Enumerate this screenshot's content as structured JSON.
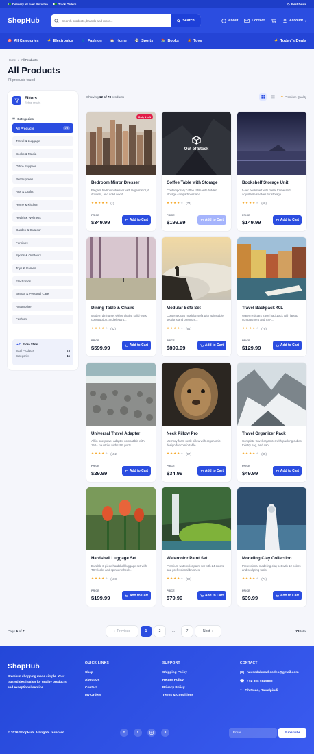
{
  "topbar": {
    "delivery": "Delivery all over Pakistan",
    "track": "Track Orders",
    "deals": "Best Deals"
  },
  "header": {
    "logo": "ShopHub",
    "search_placeholder": "Search products, brands and more...",
    "search_button": "Search",
    "about": "About",
    "contact": "Contact",
    "account": "Account"
  },
  "catnav": {
    "items": [
      {
        "label": "All Categories",
        "icon": "🎯"
      },
      {
        "label": "Electronics",
        "icon": "⚡"
      },
      {
        "label": "Fashion",
        "icon": "👗"
      },
      {
        "label": "Home",
        "icon": "🏠"
      },
      {
        "label": "Sports",
        "icon": "⚽"
      },
      {
        "label": "Books",
        "icon": "📚"
      },
      {
        "label": "Toys",
        "icon": "🧸"
      }
    ],
    "deals": "Today's Deals"
  },
  "breadcrumb": {
    "home": "Home",
    "sep": "/",
    "current": "All Products"
  },
  "page": {
    "title": "All Products",
    "count": "73 products found"
  },
  "sidebar": {
    "title": "Filters",
    "subtitle": "Refine results",
    "categories_label": "Categories",
    "categories": [
      {
        "label": "All Products",
        "count": "73",
        "active": true
      },
      {
        "label": "Travel & Luggage"
      },
      {
        "label": "Books & Media"
      },
      {
        "label": "Office Supplies"
      },
      {
        "label": "Pet Supplies"
      },
      {
        "label": "Arts & Crafts"
      },
      {
        "label": "Home & Kitchen"
      },
      {
        "label": "Health & Wellness"
      },
      {
        "label": "Garden & Outdoor"
      },
      {
        "label": "Furniture"
      },
      {
        "label": "Sports & Outdoors"
      },
      {
        "label": "Toys & Games"
      },
      {
        "label": "Electronics"
      },
      {
        "label": "Beauty & Personal Care"
      },
      {
        "label": "Automotive"
      },
      {
        "label": "Fashion"
      }
    ],
    "stats": {
      "title": "Store Stats",
      "total_label": "Total Products",
      "total": "73",
      "cat_label": "Categories",
      "cat": "15"
    }
  },
  "toolbar": {
    "showing_prefix": "Showing ",
    "showing_range": "12 of 73",
    "showing_suffix": " products",
    "sort": "Premium Quality"
  },
  "products": [
    {
      "title": "Bedroom Mirror Dresser",
      "desc": "Elegant bedroom dresser with large mirror, 6 drawers, and solid wood...",
      "stars": 5,
      "reviews": "(1)",
      "price_label": "PRICE",
      "price": "$349.99",
      "badge": "Only 1 left",
      "oos": "",
      "disabled": false,
      "img": "city"
    },
    {
      "title": "Coffee Table with Storage",
      "desc": "Contemporary coffee table with hidden storage compartment and...",
      "stars": 4,
      "reviews": "(73)",
      "price_label": "PRICE",
      "price": "$199.99",
      "badge": "",
      "oos": "Out of Stock",
      "disabled": true,
      "img": "mountain-dark"
    },
    {
      "title": "Bookshelf Storage Unit",
      "desc": "5-tier bookshelf with metal frame and adjustable shelves for storage.",
      "stars": 4,
      "reviews": "(68)",
      "price_label": "PRICE",
      "price": "$149.99",
      "badge": "",
      "oos": "",
      "disabled": false,
      "img": "lake-night"
    },
    {
      "title": "Dining Table & Chairs",
      "desc": "Modern dining set with 6 chairs, solid wood construction, and elegant...",
      "stars": 4,
      "reviews": "(52)",
      "price_label": "PRICE",
      "price": "$599.99",
      "badge": "",
      "oos": "",
      "disabled": false,
      "img": "forest-pink"
    },
    {
      "title": "Modular Sofa Set",
      "desc": "Contemporary modular sofa with adjustable sections and premium...",
      "stars": 4,
      "reviews": "(64)",
      "price_label": "PRICE",
      "price": "$899.99",
      "badge": "",
      "oos": "",
      "disabled": false,
      "img": "clouds"
    },
    {
      "title": "Travel Backpack 40L",
      "desc": "Water resistant travel backpack with laptop compartment and TSA...",
      "stars": 4,
      "reviews": "(78)",
      "price_label": "PRICE",
      "price": "$129.99",
      "badge": "",
      "oos": "",
      "disabled": false,
      "img": "canal"
    },
    {
      "title": "Universal Travel Adapter",
      "desc": "All-in-one power adapter compatible with 150+ countries with USB ports...",
      "stars": 4,
      "reviews": "(152)",
      "price_label": "PRICE",
      "price": "$29.99",
      "badge": "",
      "oos": "",
      "disabled": false,
      "img": "pebbles"
    },
    {
      "title": "Neck Pillow Pro",
      "desc": "Memory foam neck pillow with ergonomic design for comfortable...",
      "stars": 4,
      "reviews": "(97)",
      "price_label": "PRICE",
      "price": "$34.99",
      "badge": "",
      "oos": "",
      "disabled": false,
      "img": "lion"
    },
    {
      "title": "Travel Organizer Pack",
      "desc": "Complete travel organizer with packing cubes, toiletry bag, and cabl...",
      "stars": 4,
      "reviews": "(85)",
      "price_label": "PRICE",
      "price": "$49.99",
      "badge": "",
      "oos": "",
      "disabled": false,
      "img": "snow-mountain"
    },
    {
      "title": "Hardshell Luggage Set",
      "desc": "Durable 3-piece hardshell luggage set with TSA locks and spinner wheels.",
      "stars": 4,
      "reviews": "(108)",
      "price_label": "PRICE",
      "price": "$199.99",
      "badge": "",
      "oos": "",
      "disabled": false,
      "img": "tulips"
    },
    {
      "title": "Watercolor Paint Set",
      "desc": "Premium watercolor paint set with 24 colors and professional brushes.",
      "stars": 4,
      "reviews": "(92)",
      "price_label": "PRICE",
      "price": "$79.99",
      "badge": "",
      "oos": "",
      "disabled": false,
      "img": "waterfall"
    },
    {
      "title": "Modeling Clay Collection",
      "desc": "Professional modeling clay set with 12 colors and sculpting tools.",
      "stars": 4,
      "reviews": "(71)",
      "price_label": "PRICE",
      "price": "$39.99",
      "badge": "",
      "oos": "",
      "disabled": false,
      "img": "hooded"
    }
  ],
  "add_label": "Add to Cart",
  "pager": {
    "page_text": "Page ",
    "page": "1",
    "of_text": " of ",
    "pages": "7",
    "prev": "Previous",
    "next": "Next",
    "nums": [
      "1",
      "2",
      "...",
      "7"
    ],
    "total": "73",
    "total_suffix": " total"
  },
  "footer": {
    "logo": "ShopHub",
    "tagline": "Premium shopping made simple. Your trusted destination for quality products and exceptional service.",
    "quick_title": "QUICK LINKS",
    "quick": [
      "Shop",
      "About Us",
      "Contact",
      "My Orders"
    ],
    "support_title": "SUPPORT",
    "support": [
      "Shipping Policy",
      "Return Policy",
      "Privacy Policy",
      "Terms & Conditions"
    ],
    "contact_title": "CONTACT",
    "email": "naveedahmad.codes@gmail.com",
    "phone": "+92 306 9829800",
    "address": "7th Road, Rawalpindi",
    "copyright": "© 2026 ShopHub. All rights reserved.",
    "social": [
      "f",
      "t",
      "in",
      "li"
    ],
    "email_placeholder": "Email",
    "subscribe": "Subscribe"
  },
  "colors": {
    "primary": "#2b4de0",
    "topbar": "#1e3ec8",
    "badge": "#e11d48",
    "star": "#f5a623"
  }
}
